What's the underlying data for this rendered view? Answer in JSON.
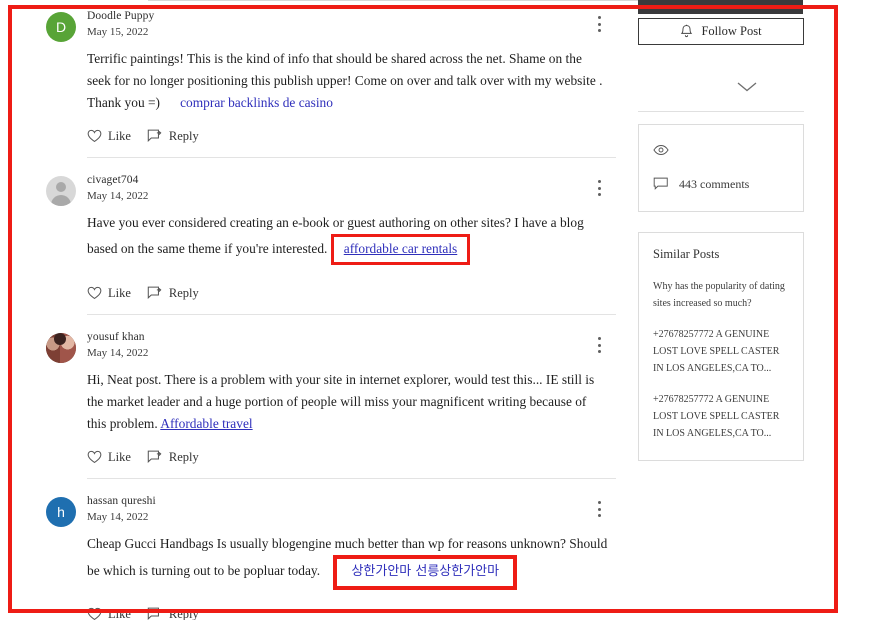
{
  "comments": [
    {
      "author": "Doodle Puppy",
      "date": "May 15, 2022",
      "avatar": {
        "type": "initial",
        "letter": "D",
        "color": "#58a437"
      },
      "text_before": "Terrific paintings! This is the  kind of info that should be shared across the net. Shame on the seek for  no longer positioning this publish upper! Come on over and talk over  with my website . Thank you =)",
      "link_text": "comprar backlinks de casino",
      "link_highlighted": false,
      "text_after": "",
      "like_label": "Like",
      "reply_label": "Reply"
    },
    {
      "author": "civaget704",
      "date": "May 14, 2022",
      "avatar": {
        "type": "placeholder",
        "letter": "",
        "color": "#d8d8d8"
      },
      "text_before": "Have you ever considered creating an e-book or guest authoring on other sites? I have a blog based on the same theme if you're interested.",
      "link_text": "affordable car rentals",
      "link_highlighted": true,
      "text_after": "",
      "like_label": "Like",
      "reply_label": "Reply"
    },
    {
      "author": "yousuf khan",
      "date": "May 14, 2022",
      "avatar": {
        "type": "photo",
        "letter": "",
        "color": "#6b4a42"
      },
      "text_before": "Hi, Neat post. There is a problem with your site in internet explorer, would test this... IE still is the market leader and a huge portion of people will miss your magnificent writing because of this problem.",
      "link_text": "Affordable travel",
      "link_highlighted": false,
      "text_after": "",
      "like_label": "Like",
      "reply_label": "Reply"
    },
    {
      "author": "hassan qureshi",
      "date": "May 14, 2022",
      "avatar": {
        "type": "initial",
        "letter": "h",
        "color": "#1f6fb0"
      },
      "text_before": "Cheap  Gucci Handbags Is usually blogengine much better than wp for reasons  unknown? Should be which is turning out to be popluar today.",
      "link_text": "상한가안마 선릉상한가안마",
      "link_highlighted": true,
      "text_after": "",
      "like_label": "Like",
      "reply_label": "Reply"
    }
  ],
  "sidebar": {
    "follow_label": "Follow Post",
    "comments_count": "443 comments",
    "similar_title": "Similar Posts",
    "similar_posts": [
      "Why has the popularity of dating sites increased so much?",
      "+27678257772 A GENUINE LOST LOVE SPELL CASTER IN LOS ANGELES,CA TO...",
      "+27678257772 A GENUINE LOST LOVE SPELL CASTER IN LOS ANGELES,CA TO..."
    ]
  },
  "annotation": {
    "outline_color": "#ee1c15",
    "highlight_color": "#ee1c15"
  }
}
